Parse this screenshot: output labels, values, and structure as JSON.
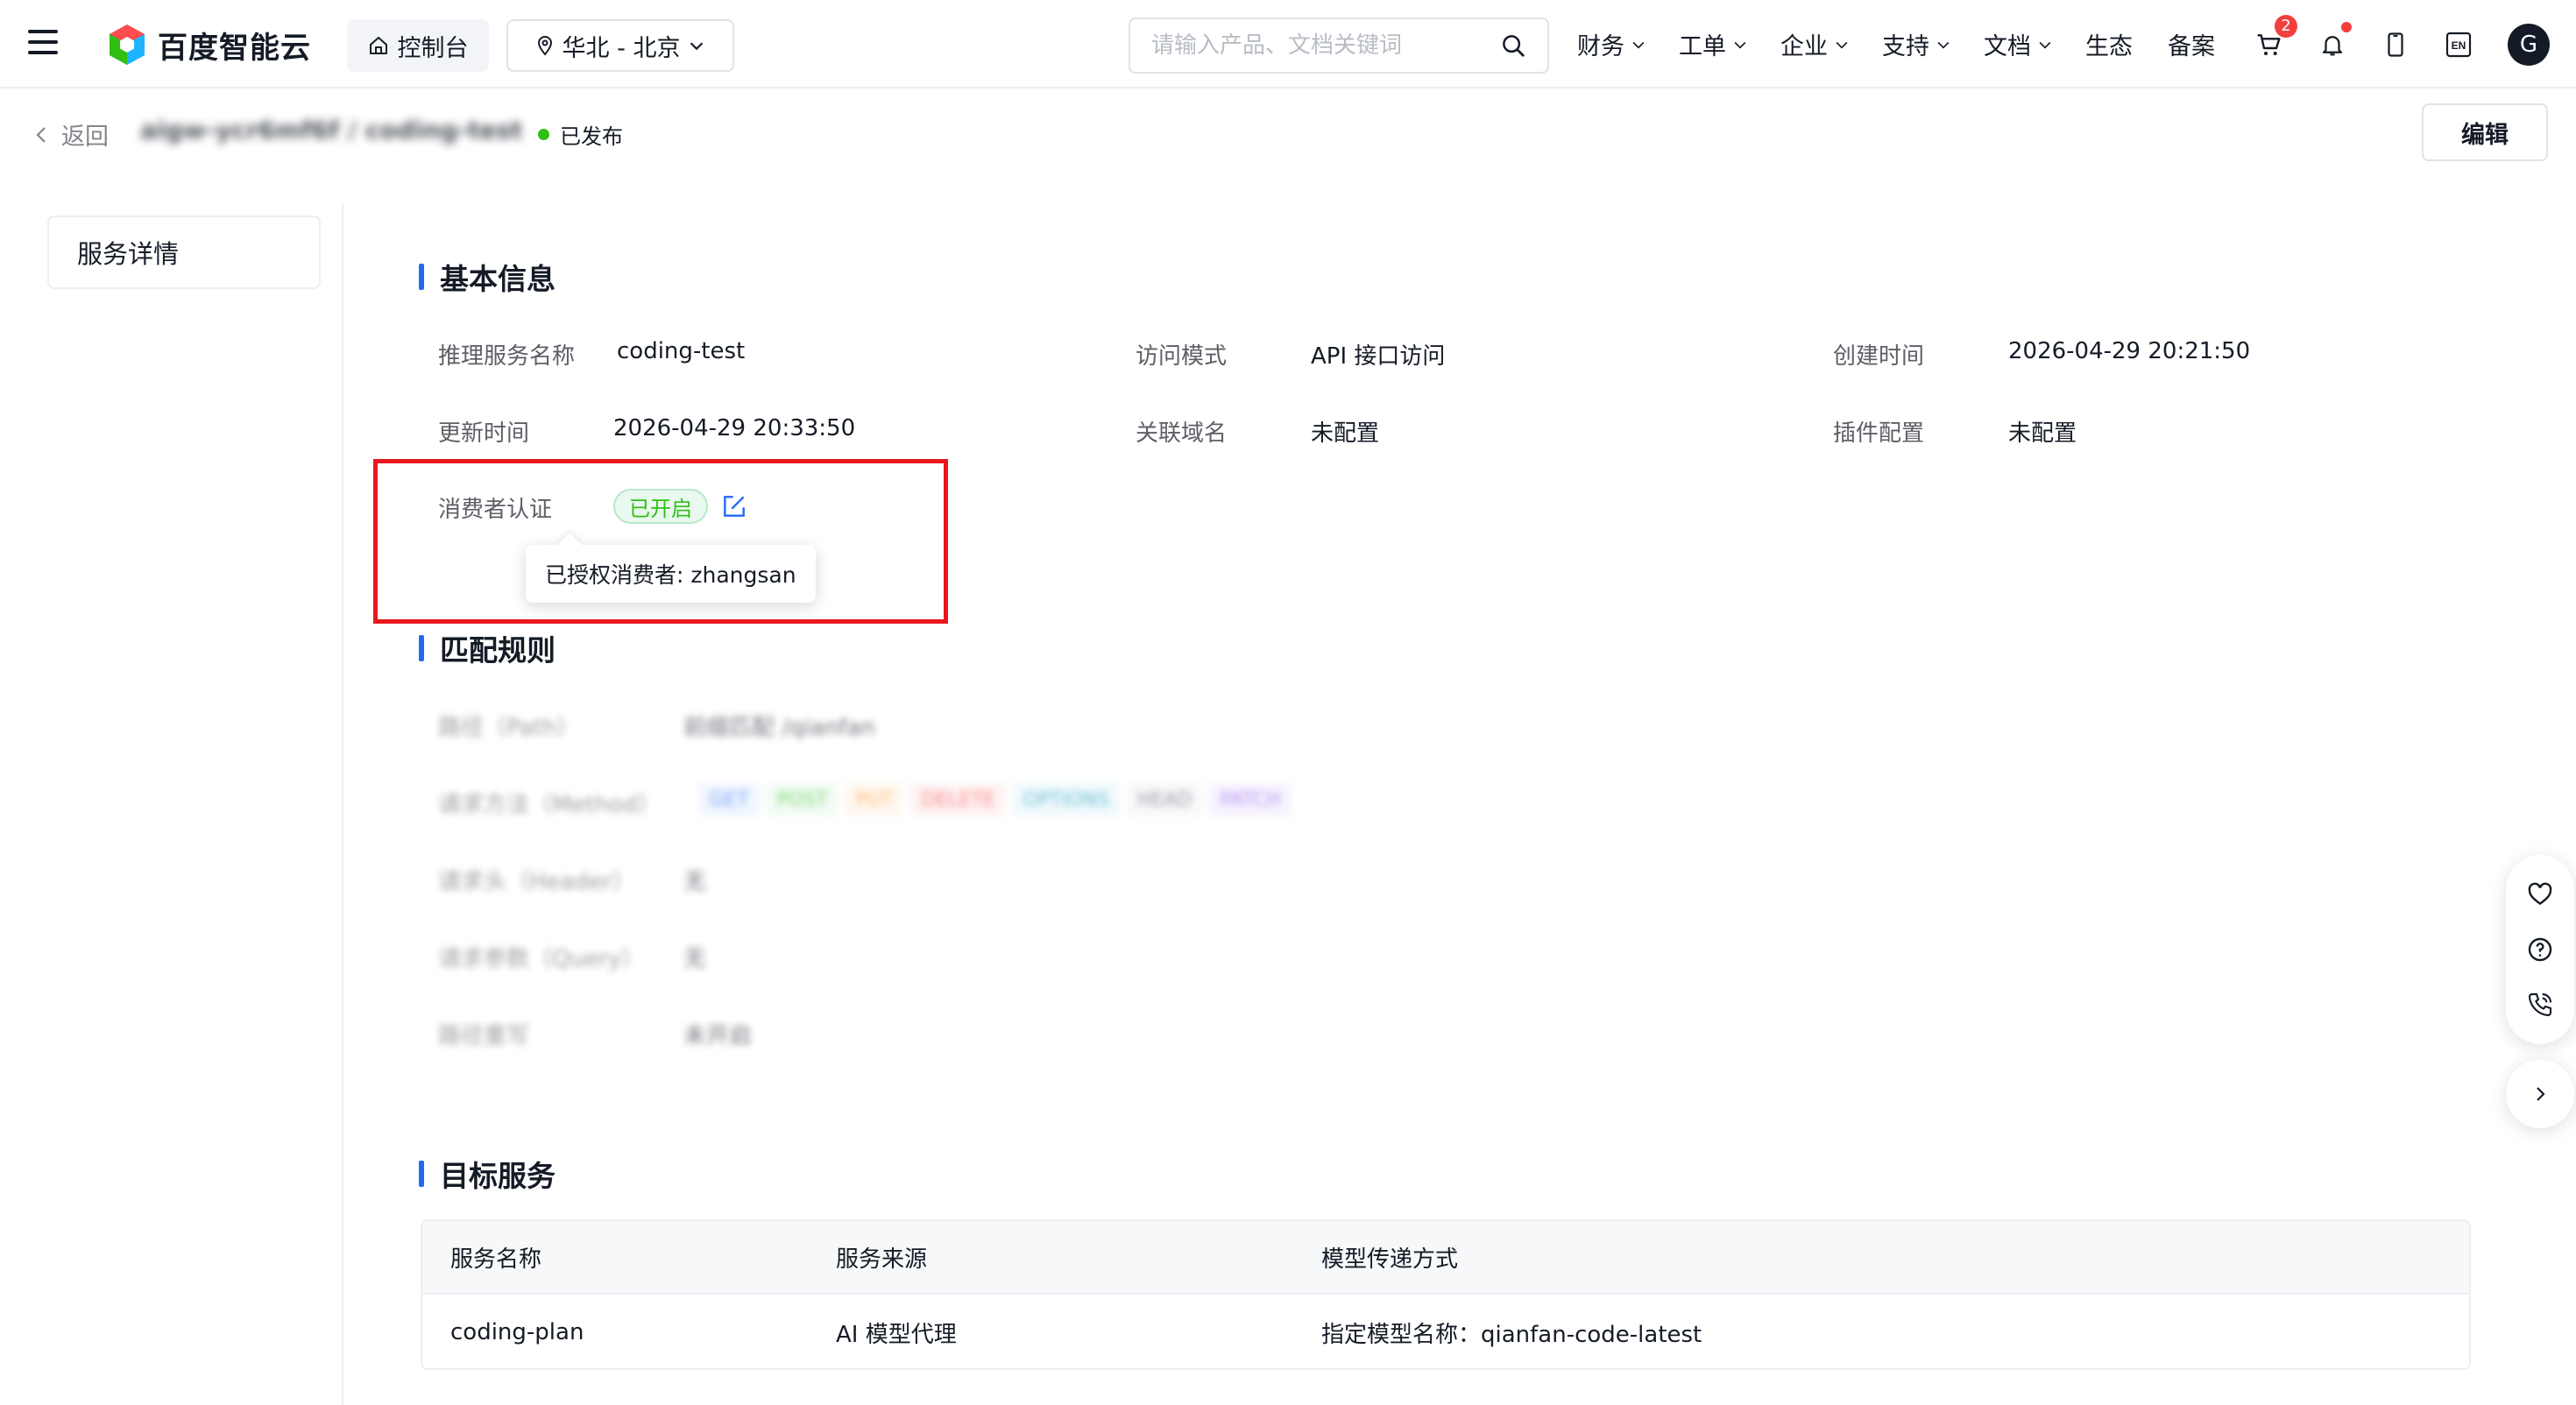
{
  "brand": {
    "name": "百度智能云"
  },
  "topbar": {
    "console_label": "控制台",
    "region_label": "华北 - 北京",
    "search_placeholder": "请输入产品、文档关键词",
    "nav": [
      {
        "label": "财务",
        "has_dropdown": true
      },
      {
        "label": "工单",
        "has_dropdown": true
      },
      {
        "label": "企业",
        "has_dropdown": true
      },
      {
        "label": "支持",
        "has_dropdown": true
      },
      {
        "label": "文档",
        "has_dropdown": true
      },
      {
        "label": "生态",
        "has_dropdown": false
      },
      {
        "label": "备案",
        "has_dropdown": false
      }
    ],
    "cart_count": "2",
    "lang_label": "EN",
    "avatar_letter": "G"
  },
  "header": {
    "back_label": "返回",
    "service_path": "aigw-ycr6mf6f / coding-test",
    "status_label": "已发布",
    "edit_label": "编辑"
  },
  "sidebar": {
    "items": [
      {
        "label": "服务详情"
      }
    ]
  },
  "basic_info": {
    "title": "基本信息",
    "fields": {
      "service_name": {
        "label": "推理服务名称",
        "value": "coding-test"
      },
      "access_mode": {
        "label": "访问模式",
        "value": "API 接口访问"
      },
      "created_time": {
        "label": "创建时间",
        "value": "2026-04-29 20:21:50"
      },
      "updated_time": {
        "label": "更新时间",
        "value": "2026-04-29 20:33:50"
      },
      "domain": {
        "label": "关联域名",
        "value": "未配置"
      },
      "plugin": {
        "label": "插件配置",
        "value": "未配置"
      },
      "consumer_auth": {
        "label": "消费者认证",
        "value": "已开启"
      }
    },
    "tooltip": "已授权消费者: zhangsan"
  },
  "match_rules": {
    "title": "匹配规则",
    "rows": [
      {
        "label": "路径（Path）",
        "value": "前缀匹配 /qianfan"
      },
      {
        "label": "请求方法（Method）",
        "value": ""
      },
      {
        "label": "请求头（Header）",
        "value": "无"
      },
      {
        "label": "请求参数（Query）",
        "value": "无"
      },
      {
        "label": "路径重写",
        "value": "未开启"
      }
    ],
    "methods": [
      {
        "label": "GET",
        "color": "#2468f2",
        "bg": "#e6f0ff"
      },
      {
        "label": "POST",
        "color": "#30bf13",
        "bg": "#e9f9ef"
      },
      {
        "label": "PUT",
        "color": "#ff9326",
        "bg": "#fff3e6"
      },
      {
        "label": "DELETE",
        "color": "#f33e3e",
        "bg": "#ffebeb"
      },
      {
        "label": "OPTIONS",
        "color": "#1593b8",
        "bg": "#e6f7fc"
      },
      {
        "label": "HEAD",
        "color": "#5c5f66",
        "bg": "#f2f4f7"
      },
      {
        "label": "PATCH",
        "color": "#8a4ff2",
        "bg": "#f2ebff"
      }
    ]
  },
  "target_service": {
    "title": "目标服务",
    "columns": [
      "服务名称",
      "服务来源",
      "模型传递方式"
    ],
    "rows": [
      [
        "coding-plan",
        "AI 模型代理",
        "指定模型名称：qianfan-code-latest"
      ]
    ]
  },
  "colors": {
    "accent": "#2468f2",
    "highlight_border": "#e8181e",
    "status_green": "#30bf13",
    "badge_red": "#f33e3e"
  },
  "icons": {
    "float_panel": [
      "heart-icon",
      "help-icon",
      "phone-icon"
    ],
    "float_button": "chevron-right-icon"
  }
}
